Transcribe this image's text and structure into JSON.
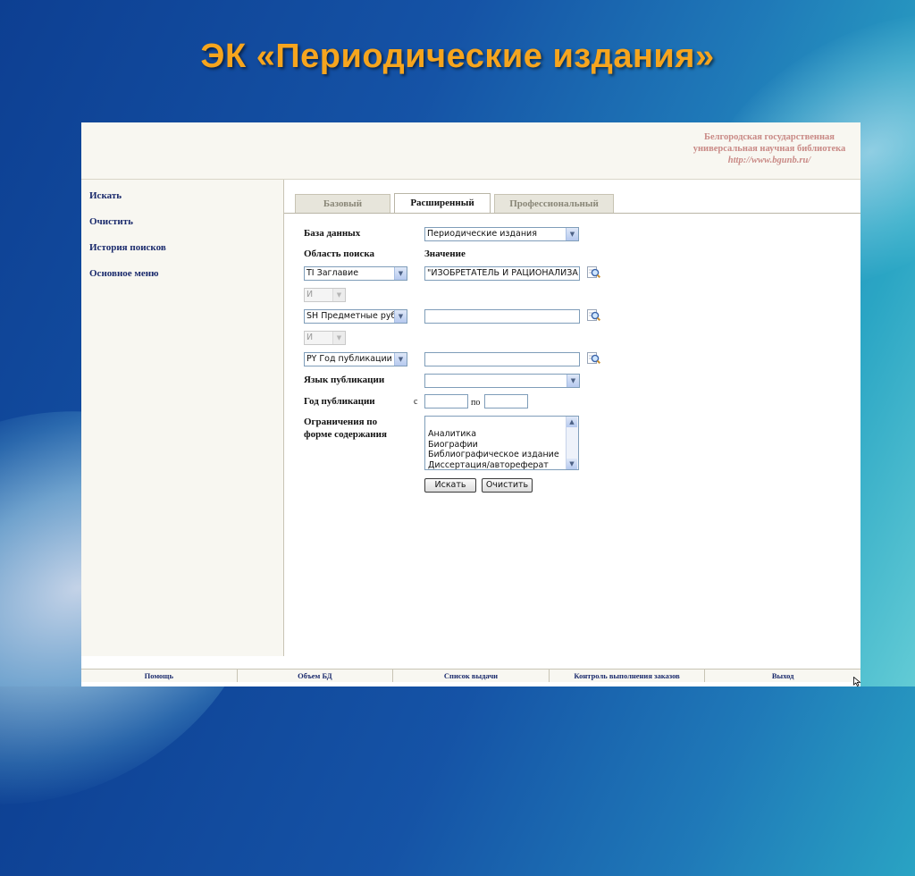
{
  "slide": {
    "title": "ЭК «Периодические издания»"
  },
  "library": {
    "name_line1": "Белгородская государственная",
    "name_line2": "универсальная научная библиотека",
    "url": "http://www.bgunb.ru/"
  },
  "left_nav": {
    "items": [
      "Искать",
      "Очистить",
      "История поисков",
      "Основное меню"
    ]
  },
  "tabs": [
    {
      "label": "Базовый",
      "active": false
    },
    {
      "label": "Расширенный",
      "active": true
    },
    {
      "label": "Профессиональный",
      "active": false
    }
  ],
  "form": {
    "database_label": "База данных",
    "database_value": "Периодические издания",
    "search_area_label": "Область поиска",
    "value_label": "Значение",
    "rows": [
      {
        "field": "TI Заглавие",
        "value": "\"ИЗОБРЕТАТЕЛЬ И РАЦИОНАЛИЗА"
      },
      {
        "field": "SH Предметные рубр",
        "value": ""
      },
      {
        "field": "PY Год публикации",
        "value": ""
      }
    ],
    "operator_1": "И",
    "operator_2": "И",
    "language_label": "Язык публикации",
    "language_value": "",
    "year_label": "Год публикации",
    "year_from_label": "с",
    "year_to_label": "по",
    "year_from_value": "",
    "year_to_value": "",
    "restrictions_label_line1": "Ограничения по",
    "restrictions_label_line2": "форме содержания",
    "restrictions_options": [
      "Аналитика",
      "Биографии",
      "Библиографическое издание",
      "Диссертация/автореферат"
    ],
    "search_button": "Искать",
    "clear_button": "Очистить"
  },
  "footer": {
    "items": [
      "Помощь",
      "Объем БД",
      "Список выдачи",
      "Контроль выполнения заказов",
      "Выход"
    ]
  },
  "colors": {
    "title_orange": "#f6a51e",
    "nav_blue": "#1a2a6c",
    "library_text": "#c98a86",
    "panel_beige": "#f8f7f1"
  }
}
